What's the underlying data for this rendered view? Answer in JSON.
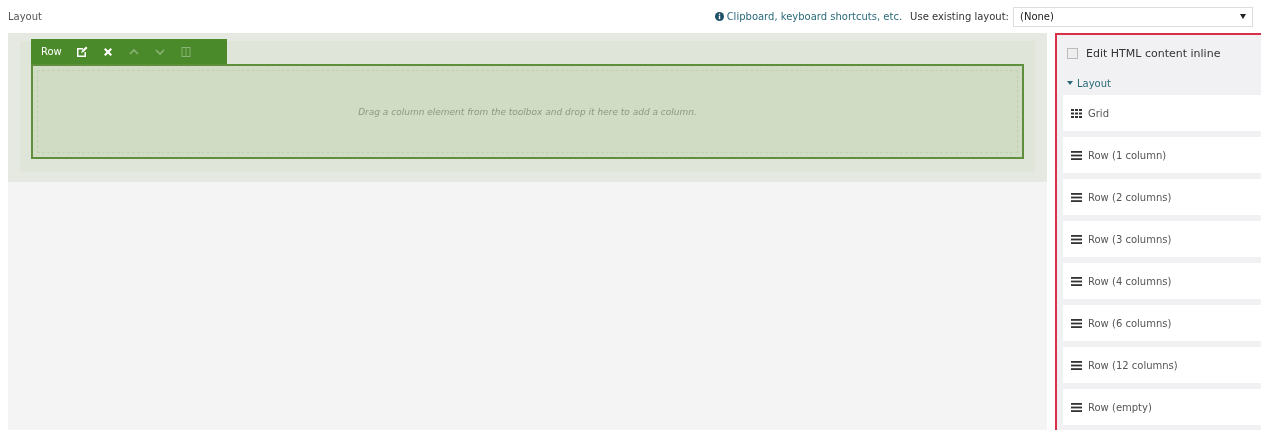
{
  "header": {
    "title": "Layout",
    "help_link": "Clipboard, keyboard shortcuts, etc.",
    "layout_label": "Use existing layout:",
    "layout_select": {
      "value": "(None)"
    }
  },
  "canvas": {
    "row": {
      "label": "Row",
      "placeholder": "Drag a column element from the toolbox and drop it here to add a column.",
      "tools": [
        {
          "kind": "edit",
          "disabled": false
        },
        {
          "kind": "delete",
          "disabled": false
        },
        {
          "kind": "up",
          "disabled": true
        },
        {
          "kind": "down",
          "disabled": true
        },
        {
          "kind": "split",
          "disabled": true
        }
      ]
    }
  },
  "toolbox": {
    "inline_edit": {
      "label": "Edit HTML content inline",
      "checked": false
    },
    "section": {
      "label": "Layout",
      "expanded": true
    },
    "items": [
      {
        "kind": "grid",
        "label": "Grid"
      },
      {
        "kind": "row",
        "label": "Row (1 column)"
      },
      {
        "kind": "row",
        "label": "Row (2 columns)"
      },
      {
        "kind": "row",
        "label": "Row (3 columns)"
      },
      {
        "kind": "row",
        "label": "Row (4 columns)"
      },
      {
        "kind": "row",
        "label": "Row (6 columns)"
      },
      {
        "kind": "row",
        "label": "Row (12 columns)"
      },
      {
        "kind": "row",
        "label": "Row (empty)"
      }
    ]
  }
}
